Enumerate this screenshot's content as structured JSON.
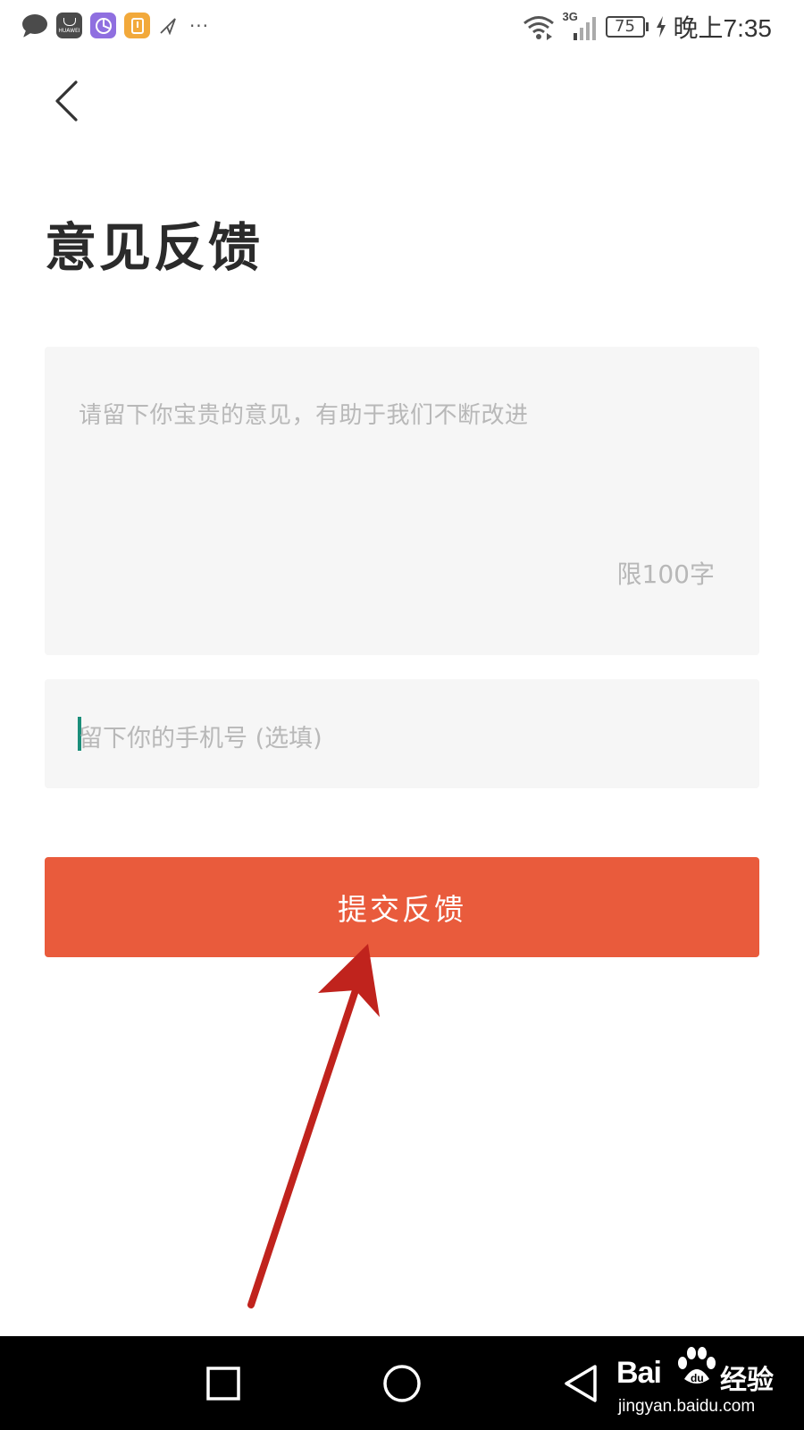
{
  "status_bar": {
    "network": "3G",
    "battery": "75",
    "time": "晚上7:35",
    "notification_icons": [
      "message-icon",
      "huawei-store-icon",
      "purple-app-icon",
      "orange-app-icon",
      "send-icon",
      "more-icon"
    ]
  },
  "header": {
    "back_icon": "chevron-left-icon"
  },
  "page": {
    "title": "意见反馈"
  },
  "feedback": {
    "placeholder": "请留下你宝贵的意见，有助于我们不断改进",
    "value": "",
    "char_limit_text": "限100字"
  },
  "phone": {
    "placeholder": "留下你的手机号 (选填)",
    "value": ""
  },
  "submit": {
    "label": "提交反馈",
    "color": "#e95b3c"
  },
  "annotation": {
    "color": "#c0231d"
  },
  "nav_bar": {
    "buttons": [
      "recent-apps-icon",
      "home-icon",
      "back-icon"
    ]
  },
  "watermark": {
    "brand": "Bai",
    "suffix": "经验",
    "url": "jingyan.baidu.com"
  }
}
